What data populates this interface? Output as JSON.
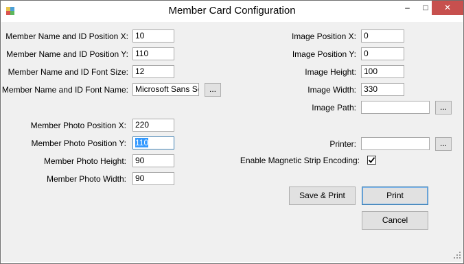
{
  "window": {
    "title": "Member Card Configuration",
    "controls": {
      "minimize": "–",
      "maximize": "□",
      "close": "✕"
    }
  },
  "left_fields": [
    {
      "label": "Member Name and ID Position X:",
      "value": "10"
    },
    {
      "label": "Member Name and ID Position Y:",
      "value": "110"
    },
    {
      "label": "Member Name and ID Font Size:",
      "value": "12"
    },
    {
      "label": "Member Name and ID Font Name:",
      "value": "Microsoft Sans Serif",
      "browse": "..."
    }
  ],
  "photo_fields": [
    {
      "label": "Member Photo Position X:",
      "value": "220"
    },
    {
      "label": "Member Photo Position Y:",
      "value": "110",
      "focused": true
    },
    {
      "label": "Member Photo Height:",
      "value": "90"
    },
    {
      "label": "Member Photo Width:",
      "value": "90"
    }
  ],
  "right_fields": [
    {
      "label": "Image Position X:",
      "value": "0"
    },
    {
      "label": "Image Position Y:",
      "value": "0"
    },
    {
      "label": "Image Height:",
      "value": "100"
    },
    {
      "label": "Image Width:",
      "value": "330"
    },
    {
      "label": "Image Path:",
      "value": "",
      "browse": "..."
    }
  ],
  "printer": {
    "label": "Printer:",
    "value": "",
    "browse": "..."
  },
  "magnetic_strip": {
    "label": "Enable Magnetic Strip Encoding:",
    "checked": true,
    "check_glyph": "✔"
  },
  "buttons": {
    "save_print": "Save & Print",
    "print": "Print",
    "cancel": "Cancel"
  },
  "colors": {
    "close_button": "#c7504e",
    "selection": "#3399ff",
    "client_bg": "#f0f0f0"
  }
}
